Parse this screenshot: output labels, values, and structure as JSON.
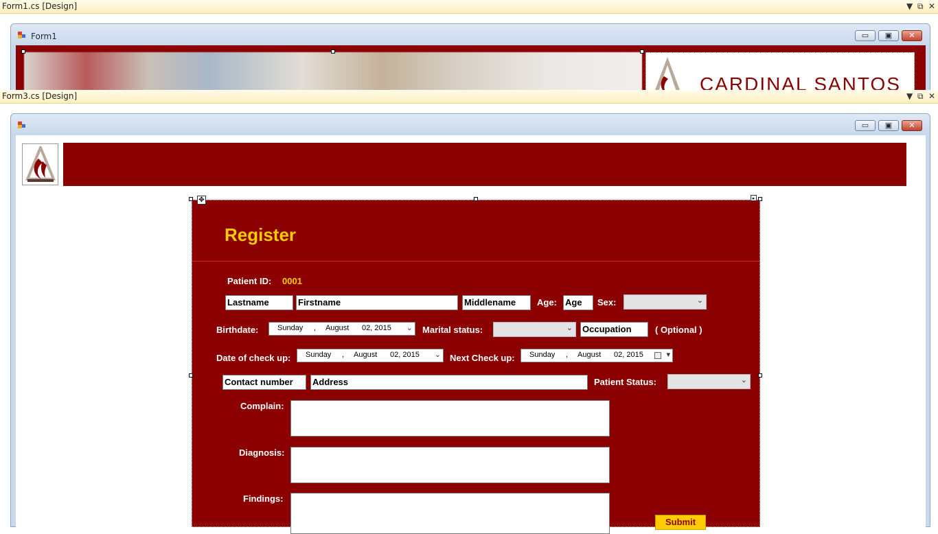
{
  "form1_tab": {
    "title": "Form1.cs [Design]",
    "pin": "▼",
    "float": "⧉",
    "close": "✕"
  },
  "form1_window": {
    "title": "Form1",
    "min": "▭",
    "max": "▣",
    "close": "✕",
    "banner_text": "CARDINAL SANTOS"
  },
  "form3_tab": {
    "title": "Form3.cs [Design]",
    "pin": "▼",
    "float": "⧉",
    "close": "✕"
  },
  "form3_window": {
    "title": "",
    "min": "▭",
    "max": "▣",
    "close": "✕"
  },
  "form": {
    "heading": "Register",
    "patient_id_label": "Patient ID:",
    "patient_id_value": "0001",
    "lastname": "Lastname",
    "firstname": "Firstname",
    "middlename": "Middlename",
    "age_label": "Age:",
    "age": "Age",
    "sex_label": "Sex:",
    "sex_value": "",
    "birthdate_label": "Birthdate:",
    "birthdate": {
      "day": "Sunday",
      "sep": ",",
      "month": "August",
      "date": "02, 2015"
    },
    "marital_label": "Marital status:",
    "marital_value": "",
    "occupation": "Occupation",
    "optional_label": "( Optional )",
    "checkup_label": "Date of check up:",
    "checkup": {
      "day": "Sunday",
      "sep": ",",
      "month": "August",
      "date": "02, 2015"
    },
    "next_checkup_label": "Next Check up:",
    "next_checkup": {
      "day": "Sunday",
      "sep": ",",
      "month": "August",
      "date": "02, 2015"
    },
    "contact": "Contact number",
    "address": "Address",
    "patient_status_label": "Patient Status:",
    "patient_status_value": "",
    "complain_label": "Complain:",
    "diagnosis_label": "Diagnosis:",
    "findings_label": "Findings:",
    "submit_label": "Submit"
  },
  "colors": {
    "maroon": "#8b0000",
    "heading": "#ffcc00",
    "submit_bg": "#ffcc00",
    "id_value": "#ffcc00"
  },
  "icons": {
    "dropdown": "chevron-down-icon",
    "calendar": "calendar-icon",
    "logo": "cardinal-santos-logo-icon",
    "move": "move-icon"
  }
}
